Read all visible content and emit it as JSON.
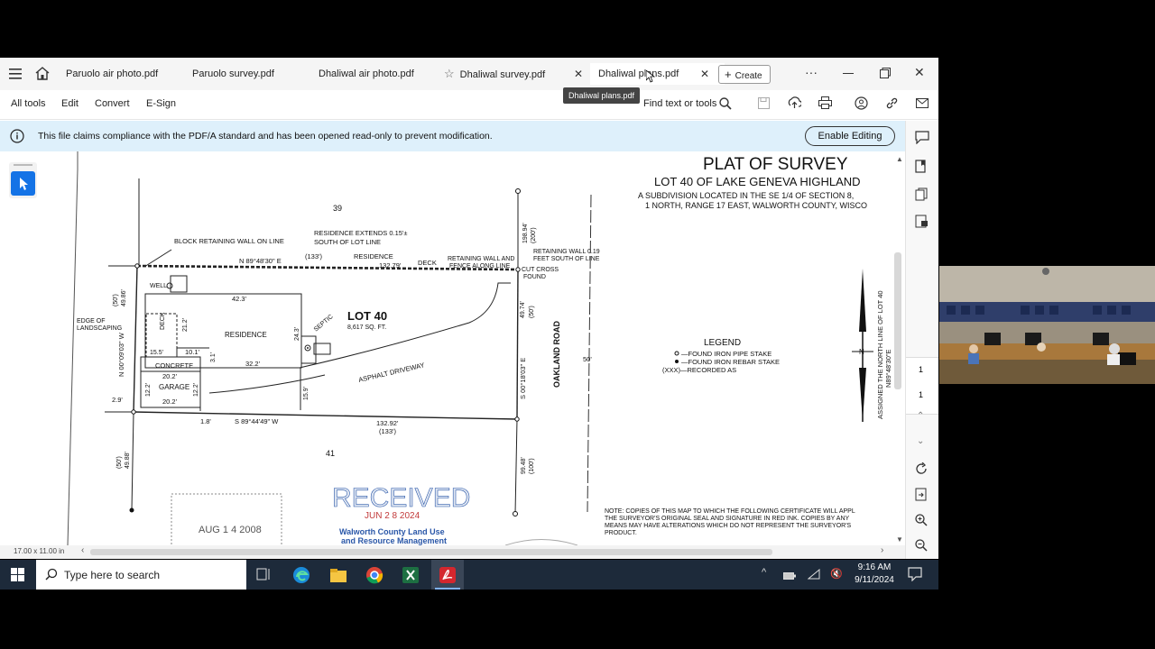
{
  "tabs": [
    {
      "label": "Paruolo air photo.pdf"
    },
    {
      "label": "Paruolo survey.pdf"
    },
    {
      "label": "Dhaliwal air photo.pdf"
    },
    {
      "label": "Dhaliwal survey.pdf"
    },
    {
      "label": "Dhaliwal plans.pdf"
    }
  ],
  "create_label": "Create",
  "tooltip": "Dhaliwal plans.pdf",
  "toolbar": {
    "all_tools": "All tools",
    "edit": "Edit",
    "convert": "Convert",
    "esign": "E-Sign",
    "find": "Find text or tools"
  },
  "infobar": {
    "message": "This file claims compliance with the PDF/A standard and has been opened read-only to prevent modification.",
    "button": "Enable Editing"
  },
  "page_size": "17.00 x 11.00 in",
  "page_numbers": [
    "1",
    "1"
  ],
  "plat": {
    "title": "PLAT OF SURVEY",
    "lot_title": "LOT 40 OF LAKE GENEVA HIGHLAND",
    "sub1": "A SUBDIVISION LOCATED IN THE SE 1/4 OF SECTION 8,",
    "sub2": "1 NORTH, RANGE 17 EAST, WALWORTH COUNTY, WISCO",
    "lot39": "39",
    "lot41": "41",
    "block_wall": "BLOCK RETAINING WALL ON LINE",
    "res_ext1": "RESIDENCE EXTENDS 0.15'±",
    "res_ext2": "SOUTH OF LOT LINE",
    "residence_top": "RESIDENCE",
    "north_bearing": "N 89°48'30\" E",
    "north_133": "(133')",
    "north_dist": "132.79'",
    "deck_top": "DECK",
    "ret_fence1": "RETAINING WALL AND",
    "ret_fence2": "FENCE ALONG LINE",
    "ret_wall1": "RETAINING WALL 0.19",
    "ret_wall2": "FEET SOUTH OF LINE",
    "cut_cross1": "CUT CROSS",
    "cut_cross2": "FOUND",
    "well": "WELL",
    "lot40": "LOT 40",
    "sqft": "8,617 SQ. FT.",
    "dim_423": "42.3'",
    "residence": "RESIDENCE",
    "septic": "SEPTIC",
    "deck_side": "DECK",
    "edge1": "EDGE OF",
    "edge2": "LANDSCAPING",
    "west_bearing": "N 00°09'03\" W",
    "west_50": "(50')",
    "west_dist": "49.86'",
    "dim_212": "21.2'",
    "dim_243": "24.3'",
    "dim_101": "10.1'",
    "dim_155": "15.5'",
    "dim_31": "3.1'",
    "dim_322": "32.2'",
    "concrete": "CONCRETE",
    "dim_202a": "20.2'",
    "garage": "GARAGE",
    "dim_202b": "20.2'",
    "dim_122a": "12.2'",
    "dim_122b": "12.2'",
    "dim_159": "15.9'",
    "driveway": "ASPHALT DRIVEWAY",
    "dim_29": "2.9'",
    "dim_18": "1.8'",
    "south_bearing": "S 89°44'49\" W",
    "south_dist": "132.92'",
    "south_133": "(133')",
    "east_bearing": "S 00°18'03\" E",
    "east_dist": "49.74'",
    "east_50": "(50')",
    "top_dist": "198.94'",
    "top_200": "(200')",
    "bot_dist": "99.48'",
    "bot_100": "(100')",
    "lower_50": "(50')",
    "lower_dist": "49.88'",
    "oakland": "OAKLAND ROAD",
    "road_50": "50'",
    "legend_title": "LEGEND",
    "legend1": "—FOUND IRON PIPE STAKE",
    "legend2": "—FOUND IRON REBAR STAKE",
    "legend3": "(XXX)—RECORDED AS",
    "assigned1": "ASSIGNED THE NORTH LINE OF LOT 40",
    "assigned2": "N89°48'30\"E",
    "north_n": "N",
    "received": "RECEIVED",
    "received_date": "JUN 2 8 2024",
    "walworth1": "Walworth County Land Use",
    "walworth2": "and Resource Management",
    "old_stamp_date": "AUG 1 4 2008",
    "note1": "NOTE: COPIES OF THIS MAP TO WHICH THE FOLLOWING CERTIFICATE WILL APPL",
    "note2": "THE SURVEYOR'S ORIGINAL SEAL AND SIGNATURE IN RED INK. COPIES BY ANY",
    "note3": "MEANS MAY HAVE ALTERATIONS WHICH DO NOT REPRESENT THE SURVEYOR'S",
    "note4": "PRODUCT."
  },
  "taskbar": {
    "search_placeholder": "Type here to search",
    "time": "9:16 AM",
    "date": "9/11/2024"
  },
  "colors": {
    "accent": "#1473e6",
    "infobar": "#def0fb",
    "taskbar": "#1d2a3a",
    "stamp_blue": "#2a57a8",
    "stamp_red": "#c23a3a"
  }
}
